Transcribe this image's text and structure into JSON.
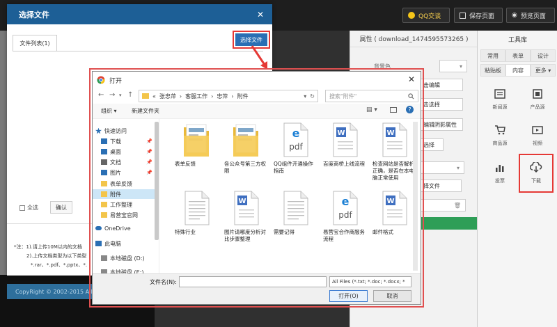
{
  "topbar": {
    "qq_service": "QQ交谈",
    "save_page": "保存页面",
    "preview_page": "预览页面"
  },
  "footer": {
    "copyright": "CopyRight © 2002-2015 All"
  },
  "properties": {
    "title": "属性 ( download_1474595573265 )",
    "bg_color_label": "背景色",
    "btn_click_edit": "击编辑",
    "btn_click_select": "击选择",
    "btn_shadow": "编辑阴影属性",
    "btn_select": "选择",
    "btn_select_file": "择文件"
  },
  "toolbox": {
    "title": "工具库",
    "tabs_row1": [
      "常用",
      "表单",
      "设计"
    ],
    "tabs_row2": [
      "粘贴板",
      "内容",
      "更多 ▾"
    ],
    "tiles": [
      {
        "label": "新闻源",
        "icon": "news-icon"
      },
      {
        "label": "产品源",
        "icon": "product-icon"
      },
      {
        "label": "商品源",
        "icon": "cart-icon"
      },
      {
        "label": "视频",
        "icon": "video-icon"
      },
      {
        "label": "投票",
        "icon": "chart-icon"
      },
      {
        "label": "下载",
        "icon": "download-icon"
      }
    ]
  },
  "select_dialog": {
    "title": "选择文件",
    "close": "✕",
    "tab_label": "文件列表(1)",
    "choose_button": "选择文件",
    "select_all": "全选",
    "confirm": "确认",
    "note_line1": "*注：1).请上传10M以内的文档",
    "note_line2": "2).上传文档类型为以下类型",
    "note_line3": "*.rar、*.pdf、*.pptx、*."
  },
  "open_dialog": {
    "title": "打开",
    "close": "✕",
    "path": [
      "张忠萍",
      "客服工作",
      "忠萍",
      "附件"
    ],
    "path_prefix": "«",
    "search_placeholder": "搜索\"附件\"",
    "organize": "组织 ▾",
    "new_folder": "新建文件夹",
    "tree": [
      {
        "label": "快速访问",
        "icon": "star-icon",
        "pin": false
      },
      {
        "label": "下载",
        "icon": "download-arrow-icon",
        "pin": true
      },
      {
        "label": "桌面",
        "icon": "desktop-icon",
        "pin": true
      },
      {
        "label": "文档",
        "icon": "document-icon",
        "pin": true
      },
      {
        "label": "图片",
        "icon": "picture-icon",
        "pin": true
      },
      {
        "label": "表单反馈",
        "icon": "folder-icon",
        "pin": false
      },
      {
        "label": "附件",
        "icon": "folder-icon",
        "pin": false
      },
      {
        "label": "工作整理",
        "icon": "folder-icon",
        "pin": false
      },
      {
        "label": "易营宝官网",
        "icon": "folder-icon",
        "pin": false
      },
      {
        "label": "OneDrive",
        "icon": "cloud-icon",
        "pin": false
      },
      {
        "label": "此电脑",
        "icon": "computer-icon",
        "pin": false
      },
      {
        "label": "本地磁盘 (D:)",
        "icon": "disk-icon",
        "pin": false
      },
      {
        "label": "本地磁盘 (E:)",
        "icon": "disk-icon",
        "pin": false
      }
    ],
    "files": [
      {
        "label": "表单反馈",
        "type": "folder"
      },
      {
        "label": "各公众号第三方权限",
        "type": "folder"
      },
      {
        "label": "QQ组件开通操作指南",
        "type": "pdf"
      },
      {
        "label": "百度商桥上线流程",
        "type": "word"
      },
      {
        "label": "检查网站是否解析正确，是否在本电脑正常使用",
        "type": "word"
      },
      {
        "label": "特殊行业",
        "type": "text"
      },
      {
        "label": "图片请哪度分析对比步骤整理",
        "type": "word"
      },
      {
        "label": "需要记得",
        "type": "text"
      },
      {
        "label": "易营宝合作商服务流程",
        "type": "pdf"
      },
      {
        "label": "邮件格式",
        "type": "word"
      }
    ],
    "filename_label": "文件名(N):",
    "filename_value": "",
    "filter": "All Files (*.txt; *.doc; *.docx; *",
    "open_button": "打开(O)",
    "cancel_button": "取消"
  },
  "colors": {
    "dialog_header": "#1d5f96",
    "highlight_red": "#e53935",
    "word_blue": "#3f6fc0",
    "pdf_blue": "#1a7fd4"
  }
}
